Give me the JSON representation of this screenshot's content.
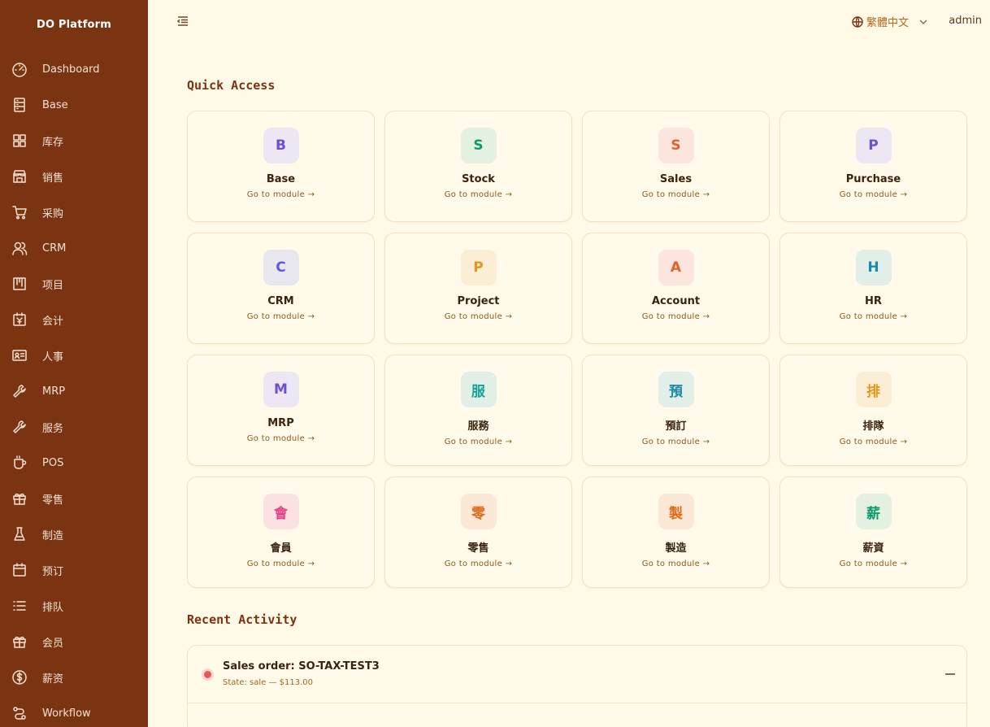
{
  "brand": "DO Platform",
  "sidebar": {
    "items": [
      {
        "label": "Dashboard",
        "icon": "dashboard-icon"
      },
      {
        "label": "Base",
        "icon": "server-icon"
      },
      {
        "label": "库存",
        "icon": "grid-icon"
      },
      {
        "label": "销售",
        "icon": "store-icon"
      },
      {
        "label": "采购",
        "icon": "cart-icon"
      },
      {
        "label": "CRM",
        "icon": "users-icon"
      },
      {
        "label": "项目",
        "icon": "kanban-icon"
      },
      {
        "label": "会计",
        "icon": "yen-calendar-icon"
      },
      {
        "label": "人事",
        "icon": "id-card-icon"
      },
      {
        "label": "MRP",
        "icon": "tools-icon"
      },
      {
        "label": "服务",
        "icon": "wrench-icon"
      },
      {
        "label": "POS",
        "icon": "coffee-icon"
      },
      {
        "label": "零售",
        "icon": "gift-icon"
      },
      {
        "label": "制造",
        "icon": "flask-icon"
      },
      {
        "label": "预订",
        "icon": "calendar-icon"
      },
      {
        "label": "排队",
        "icon": "list-icon"
      },
      {
        "label": "会员",
        "icon": "gift-icon"
      },
      {
        "label": "薪资",
        "icon": "dollar-icon"
      },
      {
        "label": "Workflow",
        "icon": "workflow-icon"
      }
    ]
  },
  "header": {
    "language": "繁體中文",
    "user": "admin"
  },
  "quick_access": {
    "title": "Quick Access",
    "link_label": "Go to module →",
    "cards": [
      {
        "letter": "B",
        "label": "Base",
        "fg": "#6b4fd8",
        "bg": "#ede6f3"
      },
      {
        "letter": "S",
        "label": "Stock",
        "fg": "#0f9a6a",
        "bg": "#e4f0e0"
      },
      {
        "letter": "S",
        "label": "Sales",
        "fg": "#e0622a",
        "bg": "#fbe5dc"
      },
      {
        "letter": "P",
        "label": "Purchase",
        "fg": "#6b4fd8",
        "bg": "#ede6f3"
      },
      {
        "letter": "C",
        "label": "CRM",
        "fg": "#5b5bd8",
        "bg": "#e8e7ee"
      },
      {
        "letter": "P",
        "label": "Project",
        "fg": "#e0981a",
        "bg": "#fbeed5"
      },
      {
        "letter": "A",
        "label": "Account",
        "fg": "#e0622a",
        "bg": "#fbe5dc"
      },
      {
        "letter": "H",
        "label": "HR",
        "fg": "#1a8aa8",
        "bg": "#e2efe8"
      },
      {
        "letter": "M",
        "label": "MRP",
        "fg": "#6b4fd8",
        "bg": "#ede6f3"
      },
      {
        "letter": "服",
        "label": "服務",
        "fg": "#14a39a",
        "bg": "#e1f0e6"
      },
      {
        "letter": "預",
        "label": "預訂",
        "fg": "#1a8aa8",
        "bg": "#e2efe8"
      },
      {
        "letter": "排",
        "label": "排隊",
        "fg": "#e0981a",
        "bg": "#fbeed5"
      },
      {
        "letter": "會",
        "label": "會員",
        "fg": "#e0468a",
        "bg": "#fbe1e2"
      },
      {
        "letter": "零",
        "label": "零售",
        "fg": "#e06a1a",
        "bg": "#fbe8d6"
      },
      {
        "letter": "製",
        "label": "製造",
        "fg": "#e06a1a",
        "bg": "#fbe8d6"
      },
      {
        "letter": "薪",
        "label": "薪資",
        "fg": "#0f9a6a",
        "bg": "#e4f0e0"
      }
    ]
  },
  "recent_activity": {
    "title": "Recent Activity",
    "items": [
      {
        "title": "Sales order: SO-TAX-TEST3",
        "subtitle": "State: sale — $113.00"
      }
    ]
  }
}
